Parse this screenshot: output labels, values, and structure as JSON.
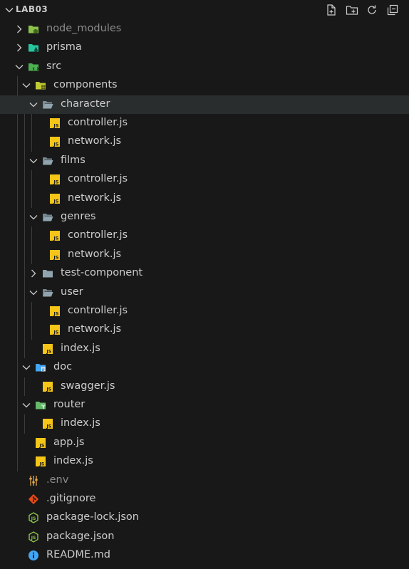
{
  "explorer": {
    "root_label": "LAB03",
    "actions": [
      {
        "name": "new-file-icon"
      },
      {
        "name": "new-folder-icon"
      },
      {
        "name": "refresh-icon"
      },
      {
        "name": "collapse-all-icon"
      }
    ],
    "items": [
      {
        "label": "node_modules",
        "type": "folder",
        "icon": "node-folder-icon",
        "color": "#8bc34a",
        "expanded": false,
        "dim": true
      },
      {
        "label": "prisma",
        "type": "folder",
        "icon": "prisma-folder-icon",
        "color": "#26c6a0",
        "expanded": false
      },
      {
        "label": "src",
        "type": "folder",
        "icon": "src-folder-icon",
        "color": "#4caf50",
        "expanded": true
      },
      {
        "label": "components",
        "type": "folder",
        "icon": "components-folder-icon",
        "color": "#c0ca33",
        "expanded": true
      },
      {
        "label": "character",
        "type": "folder",
        "icon": "folder-open-icon",
        "color": "#90a4ae",
        "expanded": true,
        "selected": true
      },
      {
        "label": "controller.js",
        "type": "file",
        "icon": "javascript-file-icon"
      },
      {
        "label": "network.js",
        "type": "file",
        "icon": "javascript-file-icon"
      },
      {
        "label": "films",
        "type": "folder",
        "icon": "folder-open-icon",
        "color": "#90a4ae",
        "expanded": true
      },
      {
        "label": "controller.js",
        "type": "file",
        "icon": "javascript-file-icon"
      },
      {
        "label": "network.js",
        "type": "file",
        "icon": "javascript-file-icon"
      },
      {
        "label": "genres",
        "type": "folder",
        "icon": "folder-open-icon",
        "color": "#90a4ae",
        "expanded": true
      },
      {
        "label": "controller.js",
        "type": "file",
        "icon": "javascript-file-icon"
      },
      {
        "label": "network.js",
        "type": "file",
        "icon": "javascript-file-icon"
      },
      {
        "label": "test-component",
        "type": "folder",
        "icon": "folder-icon",
        "color": "#90a4ae",
        "expanded": false
      },
      {
        "label": "user",
        "type": "folder",
        "icon": "folder-open-icon",
        "color": "#90a4ae",
        "expanded": true
      },
      {
        "label": "controller.js",
        "type": "file",
        "icon": "javascript-file-icon"
      },
      {
        "label": "network.js",
        "type": "file",
        "icon": "javascript-file-icon"
      },
      {
        "label": "index.js",
        "type": "file",
        "icon": "javascript-file-icon"
      },
      {
        "label": "doc",
        "type": "folder",
        "icon": "doc-folder-icon",
        "color": "#42a5f5",
        "expanded": true
      },
      {
        "label": "swagger.js",
        "type": "file",
        "icon": "javascript-file-icon"
      },
      {
        "label": "router",
        "type": "folder",
        "icon": "router-folder-icon",
        "color": "#66bb6a",
        "expanded": true
      },
      {
        "label": "index.js",
        "type": "file",
        "icon": "javascript-file-icon"
      },
      {
        "label": "app.js",
        "type": "file",
        "icon": "javascript-file-icon"
      },
      {
        "label": "index.js",
        "type": "file",
        "icon": "javascript-file-icon"
      },
      {
        "label": ".env",
        "type": "file",
        "icon": "env-settings-icon",
        "color": "#e5a84b",
        "dim": true
      },
      {
        "label": ".gitignore",
        "type": "file",
        "icon": "git-icon",
        "color": "#e64a19"
      },
      {
        "label": "package-lock.json",
        "type": "file",
        "icon": "nodejs-icon",
        "color": "#8bc34a"
      },
      {
        "label": "package.json",
        "type": "file",
        "icon": "nodejs-icon",
        "color": "#8bc34a"
      },
      {
        "label": "README.md",
        "type": "file",
        "icon": "info-icon",
        "color": "#42a5f5"
      }
    ]
  }
}
